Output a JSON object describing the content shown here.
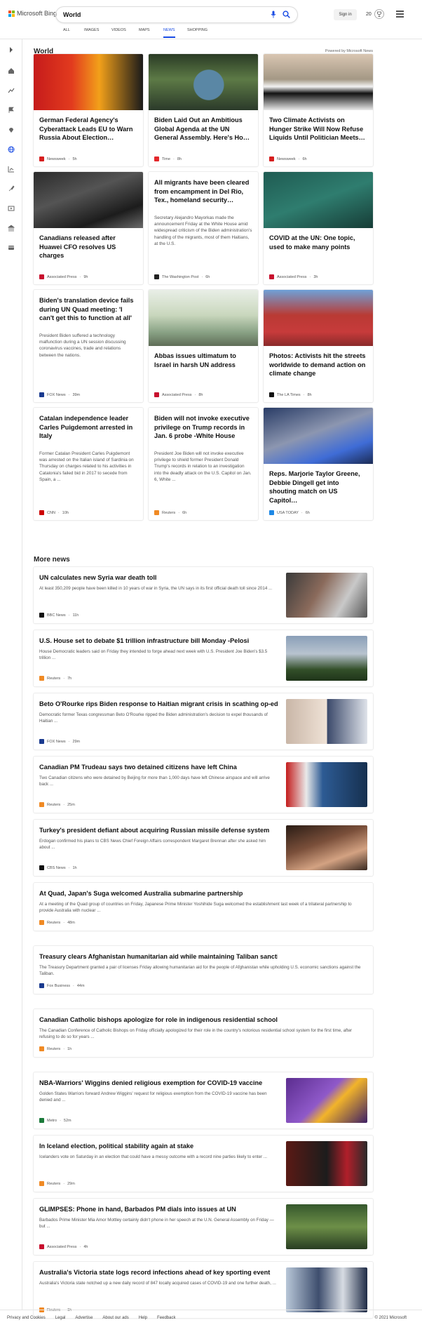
{
  "header": {
    "brand": "Microsoft Bing",
    "query": "World",
    "signin": "Sign in",
    "points": "20"
  },
  "tabs": [
    "ALL",
    "IMAGES",
    "VIDEOS",
    "MAPS",
    "NEWS",
    "SHOPPING"
  ],
  "active_tab": "NEWS",
  "world": {
    "title": "World",
    "powered": "Powered by Microsoft News",
    "cards": [
      {
        "title": "German Federal Agency's Cyberattack Leads EU to Warn Russia About Election…",
        "snippet": "",
        "source": "Newsweek",
        "time": "5h",
        "src_color": "#d61e1e"
      },
      {
        "title": "Biden Laid Out an Ambitious Global Agenda at the UN General Assembly. Here's Ho…",
        "snippet": "",
        "source": "Time",
        "time": "8h",
        "src_color": "#e3272b"
      },
      {
        "title": "Two Climate Activists on Hunger Strike Will Now Refuse Liquids Until Politician Meets…",
        "snippet": "",
        "source": "Newsweek",
        "time": "6h",
        "src_color": "#d61e1e"
      },
      {
        "title": "Canadians released after Huawei CFO resolves US charges",
        "snippet": "",
        "source": "Associated Press",
        "time": "9h",
        "src_color": "#c8102e"
      },
      {
        "title": "All migrants have been cleared from encampment in Del Rio, Tex., homeland security…",
        "snippet": "Secretary Alejandro Mayorkas made the announcement Friday at the White House amid widespread criticism of the Biden administration's handling of the migrants, most of them Haitians, at the U.S.",
        "source": "The Washington Post",
        "time": "6h",
        "src_color": "#222"
      },
      {
        "title": "COVID at the UN: One topic, used to make many points",
        "snippet": "",
        "source": "Associated Press",
        "time": "3h",
        "src_color": "#c8102e"
      },
      {
        "title": "Biden's translation device fails during UN Quad meeting: 'I can't get this to function at all'",
        "snippet": "President Biden suffered a technology malfunction during a UN session discussing coronavirus vaccines, trade and relations between the nations.",
        "source": "FOX News",
        "time": "39m",
        "src_color": "#1a3a8f"
      },
      {
        "title": "Abbas issues ultimatum to Israel in harsh UN address",
        "snippet": "",
        "source": "Associated Press",
        "time": "8h",
        "src_color": "#c8102e"
      },
      {
        "title": "Photos: Activists hit the streets worldwide to demand action on climate change",
        "snippet": "",
        "source": "The LA Times",
        "time": "8h",
        "src_color": "#111"
      },
      {
        "title": "Catalan independence leader Carles Puigdemont arrested in Italy",
        "snippet": "Former Catalan President Carles Puigdemont was arrested on the Italian island of Sardinia on Thursday on charges related to his activities in Catalonia's failed bid in 2017 to secede from Spain, a ...",
        "source": "CNN",
        "time": "10h",
        "src_color": "#cc0000"
      },
      {
        "title": "Biden will not invoke executive privilege on Trump records in Jan. 6 probe -White House",
        "snippet": "President Joe Biden will not invoke executive privilege to shield former President Donald Trump's records in relation to an investigation into the deadly attack on the U.S. Capitol on Jan. 6, White ...",
        "source": "Reuters",
        "time": "6h",
        "src_color": "#f08a24"
      },
      {
        "title": "Reps. Marjorie Taylor Greene, Debbie Dingell get into shouting match on US Capitol…",
        "snippet": "",
        "source": "USA TODAY",
        "time": "6h",
        "src_color": "#1e88e5"
      }
    ]
  },
  "more": {
    "title": "More news",
    "items": [
      {
        "title": "UN calculates new Syria war death toll",
        "snippet": "At least 350,209 people have been killed in 10 years of war in Syria, the UN says in its first official death toll since 2014 ...",
        "source": "BBC News",
        "time": "11h",
        "src_color": "#111",
        "thumb": true
      },
      {
        "title": "U.S. House set to debate $1 trillion infrastructure bill Monday -Pelosi",
        "snippet": "House Democratic leaders said on Friday they intended to forge ahead next week with U.S. President Joe Biden's $3.5 trillion ...",
        "source": "Reuters",
        "time": "7h",
        "src_color": "#f08a24",
        "thumb": true
      },
      {
        "title": "Beto O'Rourke rips Biden response to Haitian migrant crisis in scathing op-ed",
        "snippet": "Democratic former Texas congressman Beto O'Rourke ripped the Biden administration's decision to expel thousands of Haitian ...",
        "source": "FOX News",
        "time": "29m",
        "src_color": "#1a3a8f",
        "thumb": true
      },
      {
        "title": "Canadian PM Trudeau says two detained citizens have left China",
        "snippet": "Two Canadian citizens who were detained by Beijing for more than 1,000 days have left Chinese airspace and will arrive back ...",
        "source": "Reuters",
        "time": "25m",
        "src_color": "#f08a24",
        "thumb": true
      },
      {
        "title": "Turkey's president defiant about acquiring Russian missile defense system",
        "snippet": "Erdogan confirmed his plans to CBS News Chief Foreign Affairs correspondent Margaret Brennan after she asked him about ...",
        "source": "CBS News",
        "time": "1h",
        "src_color": "#111",
        "thumb": true
      },
      {
        "title": "At Quad, Japan's Suga welcomed Australia submarine partnership",
        "snippet": "At a meeting of the Quad group of countries on Friday, Japanese Prime Minister Yoshihide Suga welcomed the establishment last week of a trilateral partnership to provide Australia with nuclear ...",
        "source": "Reuters",
        "time": "48m",
        "src_color": "#f08a24",
        "thumb": false
      },
      {
        "title": "Treasury clears Afghanistan humanitarian aid while maintaining Taliban sanctions",
        "snippet": "The Treasury Department granted a pair of licenses Friday allowing humanitarian aid for the people of Afghanistan while upholding U.S. economic sanctions against the Taliban.",
        "source": "Fox Business",
        "time": "44m",
        "src_color": "#1a3a8f",
        "thumb": false
      },
      {
        "title": "Canadian Catholic bishops apologize for role in indigenous residential schools",
        "snippet": "The Canadian Conference of Catholic Bishops on Friday officially apologized for their role in the country's notorious residential school system for the first time, after refusing to do so for years ...",
        "source": "Reuters",
        "time": "1h",
        "src_color": "#f08a24",
        "thumb": false
      },
      {
        "title": "NBA-Warriors' Wiggins denied religious exemption for COVID-19 vaccine",
        "snippet": "Golden States Warriors forward Andrew Wiggins' request for religious exemption from the COVID-19 vaccine has been denied and ...",
        "source": "Metro",
        "time": "52m",
        "src_color": "#1b7a3a",
        "thumb": true
      },
      {
        "title": "In Iceland election, political stability again at stake",
        "snippet": "Icelanders vote on Saturday in an election that could have a messy outcome with a record nine parties likely to enter ...",
        "source": "Reuters",
        "time": "29m",
        "src_color": "#f08a24",
        "thumb": true
      },
      {
        "title": "GLIMPSES: Phone in hand, Barbados PM dials into issues at UN",
        "snippet": "Barbados Prime Minister Mia Amor Mottley certainly didn't phone in her speech at the U.N. General Assembly on Friday — but ...",
        "source": "Associated Press",
        "time": "4h",
        "src_color": "#c8102e",
        "thumb": true
      },
      {
        "title": "Australia's Victoria state logs record infections ahead of key sporting event",
        "snippet": "Australia's Victoria state notched up a new daily record of 847 locally acquired cases of COVID-19 and one further death, ...",
        "source": "Reuters",
        "time": "1h",
        "src_color": "#f08a24",
        "thumb": true
      }
    ]
  },
  "footer": {
    "links": [
      "Privacy and Cookies",
      "Legal",
      "Advertise",
      "About our ads",
      "Help",
      "Feedback"
    ],
    "copyright": "© 2021 Microsoft"
  }
}
